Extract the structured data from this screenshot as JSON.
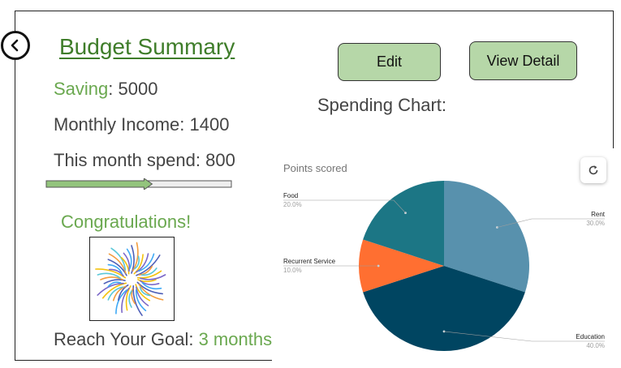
{
  "header": {
    "title": "Budget Summary",
    "back_icon": "chevron-left-icon"
  },
  "stats": {
    "saving_label": "Saving",
    "saving_value": ": 5000",
    "income_text": "Monthly Income: 1400",
    "spend_text": "This month spend: 800"
  },
  "progress": {
    "fraction": 0.55,
    "fill_color": "#93c47d",
    "track_color": "#eeeeee"
  },
  "congrats": {
    "text": "Congratulations!",
    "image_icon": "fireworks-icon"
  },
  "goal": {
    "label": "Reach Your Goal: ",
    "value": "3 months"
  },
  "buttons": {
    "edit": "Edit",
    "view_detail": "View Detail"
  },
  "chart_heading": "Spending Chart:",
  "chart_data": {
    "type": "pie",
    "title": "Points scored",
    "slices": [
      {
        "label": "Rent",
        "percent_text": "30.0%",
        "value": 30,
        "color": "#5891ad"
      },
      {
        "label": "Education",
        "percent_text": "40.0%",
        "value": 40,
        "color": "#004561"
      },
      {
        "label": "Recurrent Service",
        "percent_text": "10.0%",
        "value": 10,
        "color": "#ff6f31"
      },
      {
        "label": "Food",
        "percent_text": "20.0%",
        "value": 20,
        "color": "#1c7685"
      }
    ]
  },
  "chart_tools": {
    "refresh_icon": "refresh-icon"
  }
}
